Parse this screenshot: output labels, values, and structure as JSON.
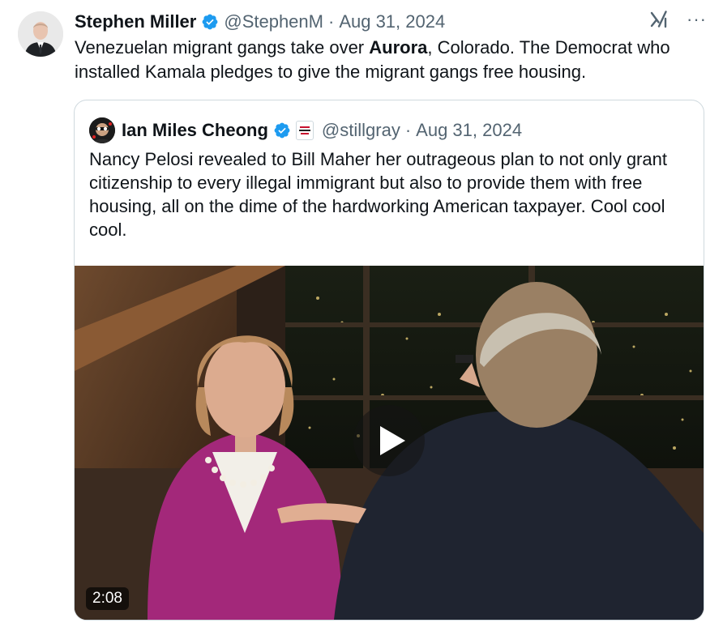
{
  "tweet": {
    "author": {
      "name": "Stephen Miller",
      "handle": "@StephenM",
      "date": "Aug 31, 2024",
      "verified": true
    },
    "text_before": "Venezuelan migrant gangs take over ",
    "text_bold": "Aurora",
    "text_after": ", Colorado. The Democrat who installed Kamala pledges to give the migrant gangs free housing.",
    "more_label": "···"
  },
  "quoted": {
    "author": {
      "name": "Ian Miles Cheong",
      "handle": "@stillgray",
      "date": "Aug 31, 2024",
      "verified": true
    },
    "text": "Nancy Pelosi revealed to Bill Maher her outrageous plan to not only grant citizenship to every illegal immigrant but also to provide them with free housing, all on the dime of the hardworking American taxpayer. Cool cool cool.",
    "video": {
      "duration": "2:08"
    }
  },
  "separator": "·",
  "icons": {
    "verified": "verified-badge-icon",
    "grok": "grok-icon",
    "more": "more-options-icon",
    "play": "play-icon",
    "affiliation": "affiliation-badge-icon"
  },
  "colors": {
    "verified": "#1d9bf0",
    "text": "#0f1419",
    "muted": "#536471",
    "border": "#cfd9de"
  }
}
